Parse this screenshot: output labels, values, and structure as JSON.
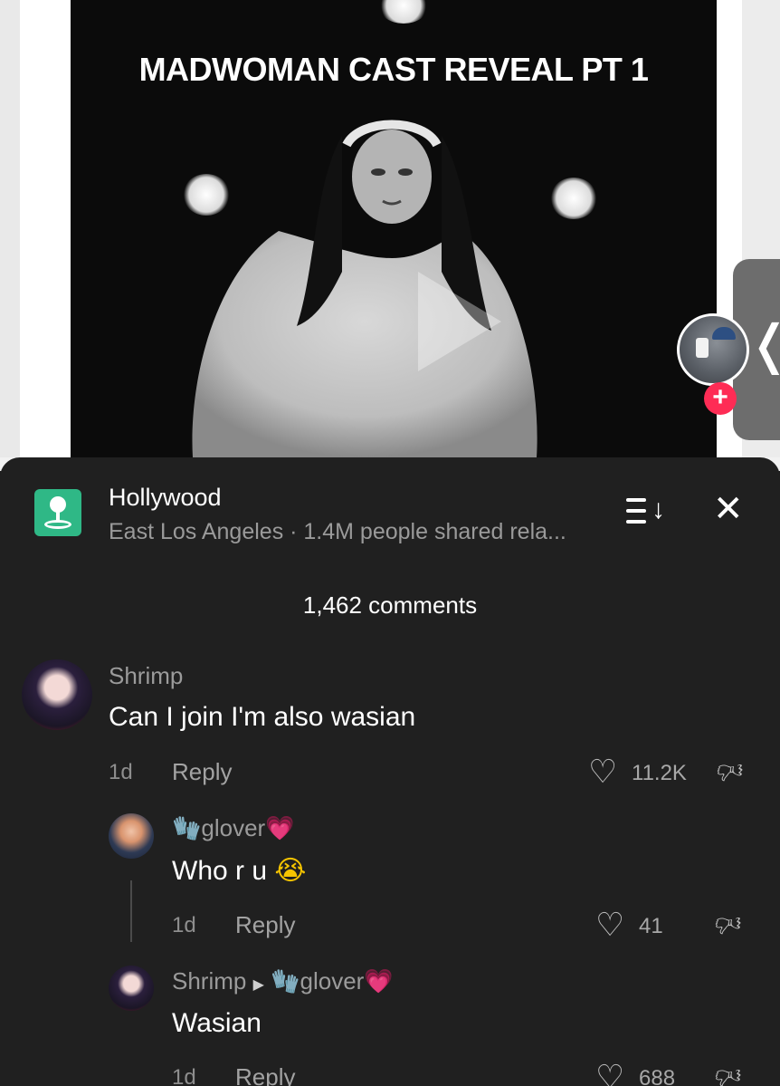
{
  "video": {
    "title": "MADWOMAN CAST REVEAL PT 1",
    "play_icon": "play-icon"
  },
  "creator": {
    "follow_icon": "plus-icon"
  },
  "side_tab": {
    "icon": "chevron-left-icon",
    "glyph": "❬"
  },
  "location": {
    "icon": "location-pin-icon",
    "title": "Hollywood",
    "subtitle": "East Los Angeles · 1.4M people shared rela..."
  },
  "header": {
    "sort_icon": "sort-icon",
    "close_icon": "close-icon",
    "close_glyph": "✕",
    "comments_count": "1,462 comments"
  },
  "comments": [
    {
      "user": "Shrimp",
      "text": "Can I join I'm also wasian",
      "time": "1d",
      "reply_label": "Reply",
      "likes": "11.2K"
    },
    {
      "user_emoji": "🧤",
      "user": "glover",
      "user_suffix_emoji": "💗",
      "text": "Who r u",
      "text_emoji": "😭",
      "time": "1d",
      "reply_label": "Reply",
      "likes": "41"
    },
    {
      "user": "Shrimp",
      "reply_to_emoji": "🧤",
      "reply_to": "glover",
      "reply_to_suffix_emoji": "💗",
      "text": "Wasian",
      "time": "1d",
      "reply_label": "Reply",
      "likes": "688"
    }
  ],
  "colors": {
    "accent_red": "#fe2c55",
    "location_green": "#2fb886",
    "sheet_bg": "#202020"
  }
}
